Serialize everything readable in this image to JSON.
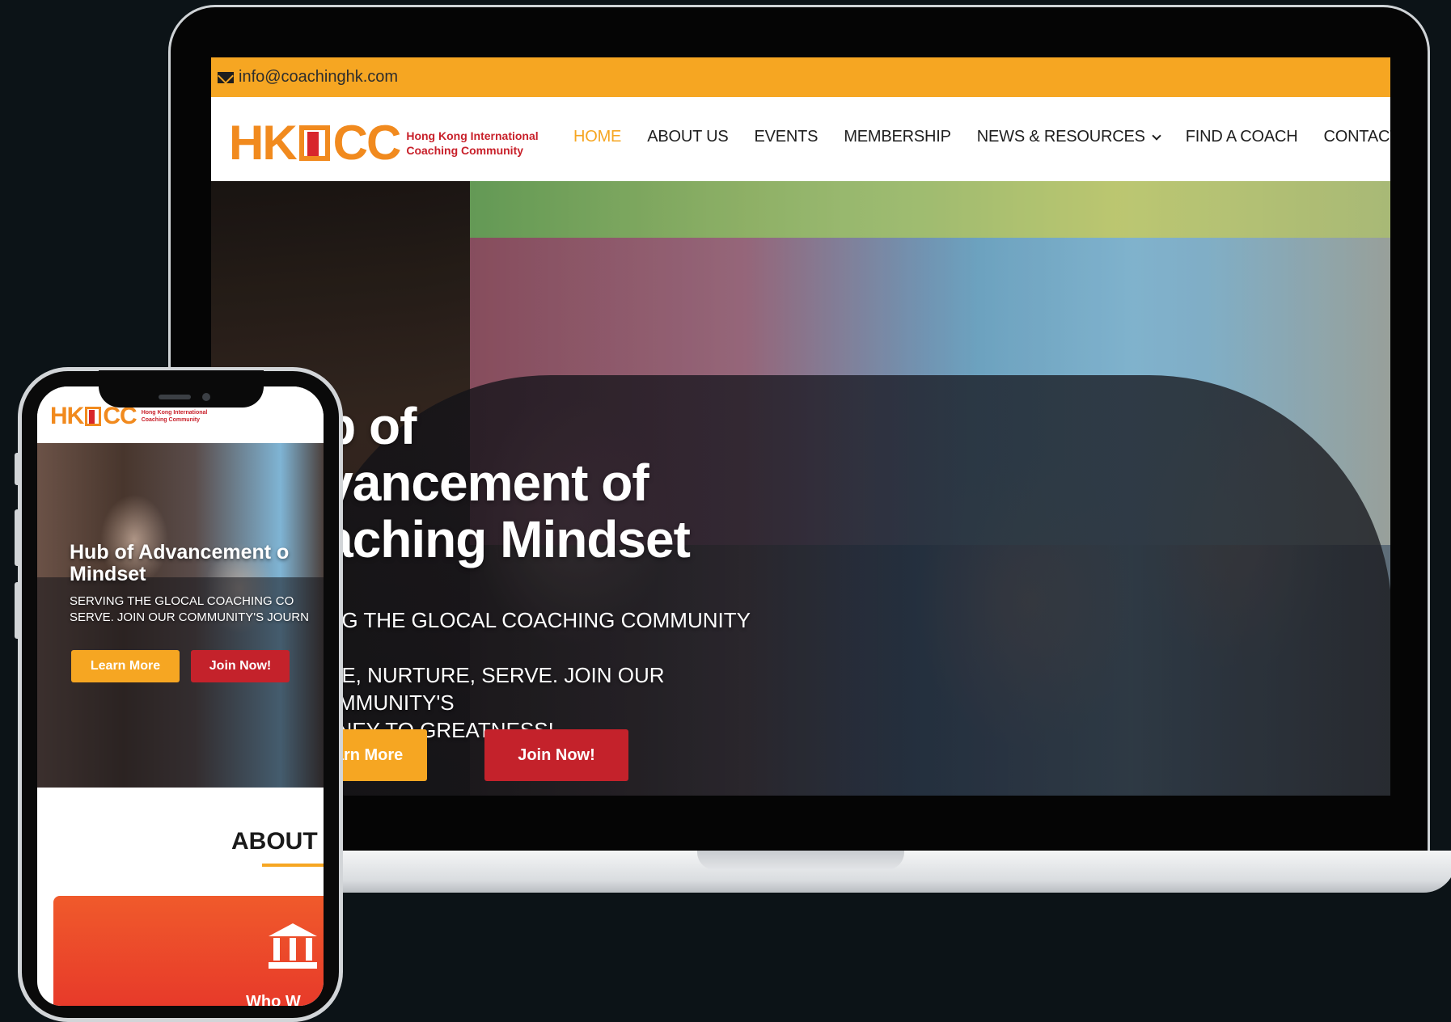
{
  "desktop": {
    "topbar": {
      "email": "info@coachinghk.com"
    },
    "logo": {
      "mark": "HK",
      "mark_end": "CC",
      "line1": "Hong Kong International",
      "line2": "Coaching Community"
    },
    "nav": {
      "home": "HOME",
      "about": "ABOUT US",
      "events": "EVENTS",
      "membership": "MEMBERSHIP",
      "news": "NEWS & RESOURCES",
      "find": "FIND A COACH",
      "contact": "CONTACT US"
    },
    "hero": {
      "title_line1": "ub of",
      "title_line2": "dvancement of",
      "title_line3": "oaching Mindset",
      "sub_line1": "VING THE GLOCAL COACHING COMMUNITY –",
      "sub_line2": "PIRE, NURTURE, SERVE. JOIN OUR COMMUNITY'S",
      "sub_line3": "URNEY TO GREATNESS!",
      "learn": "earn More",
      "join": "Join Now!"
    }
  },
  "mobile": {
    "logo": {
      "mark": "HK",
      "mark_end": "CC",
      "line1": "Hong Kong International",
      "line2": "Coaching Community"
    },
    "hero": {
      "title_line1": "Hub of Advancement o",
      "title_line2": "Mindset",
      "sub_line1": "SERVING THE GLOCAL COACHING CO",
      "sub_line2": "SERVE. JOIN OUR COMMUNITY'S JOURN",
      "learn": "Learn More",
      "join": "Join Now!"
    },
    "about": {
      "heading": "ABOUT",
      "card_label": "Who W"
    }
  },
  "colors": {
    "accent": "#f6a622",
    "brand_red": "#c4222b",
    "logo_orange": "#f18a1e",
    "background": "#0c1317"
  }
}
